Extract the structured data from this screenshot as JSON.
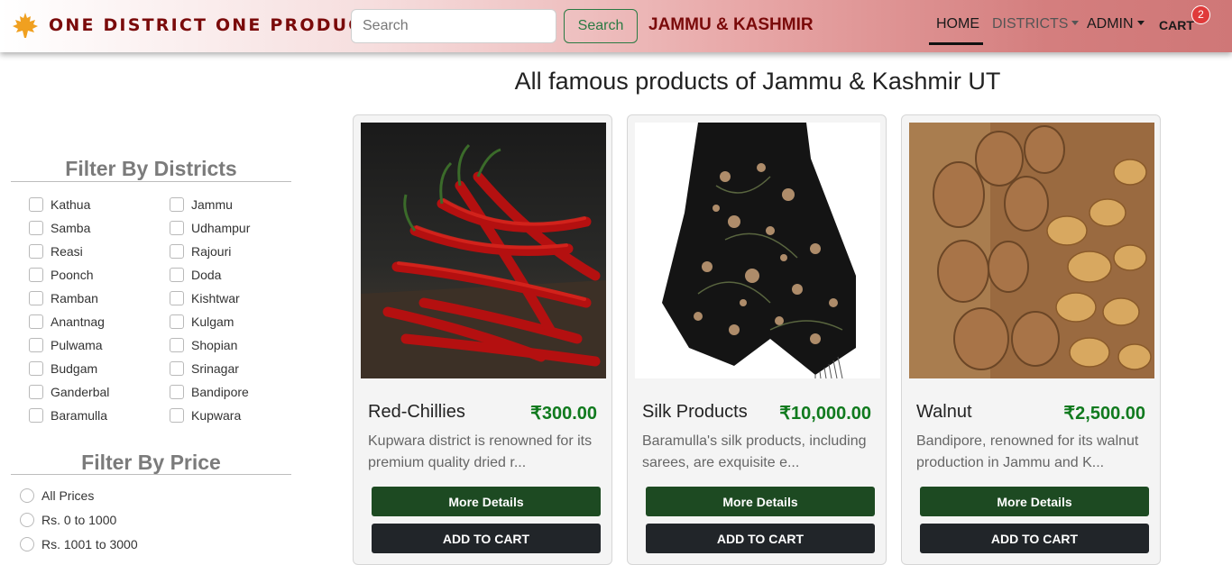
{
  "navbar": {
    "brand_icon": "maple-leaf-icon",
    "brand": "ONE DISTRICT ONE PRODUCT",
    "search_placeholder": "Search",
    "search_button": "Search",
    "state": "JAMMU & KASHMIR",
    "links": {
      "home": "HOME",
      "districts": "DISTRICTS",
      "admin": "ADMIN",
      "cart": "CART"
    },
    "cart_count": "2"
  },
  "colors": {
    "brand": "#7a0a0a",
    "accent_green": "#1d4a22",
    "price_green": "#107a1e",
    "badge_red": "#e03a3a"
  },
  "page_title": "All famous products of Jammu & Kashmir UT",
  "filters": {
    "districts_heading": "Filter By Districts",
    "districts_col1": [
      "Kathua",
      "Samba",
      "Reasi",
      "Poonch",
      "Ramban",
      "Anantnag",
      "Pulwama",
      "Budgam",
      "Ganderbal",
      "Baramulla"
    ],
    "districts_col2": [
      "Jammu",
      "Udhampur",
      "Rajouri",
      "Doda",
      "Kishtwar",
      "Kulgam",
      "Shopian",
      "Srinagar",
      "Bandipore",
      "Kupwara"
    ],
    "price_heading": "Filter By Price",
    "prices": [
      "All Prices",
      "Rs. 0 to 1000",
      "Rs. 1001 to 3000"
    ]
  },
  "products": [
    {
      "name": "Red-Chillies",
      "price": "₹300.00",
      "description": "Kupwara district is renowned for its premium quality dried r...",
      "details_label": "More Details",
      "cart_label": "ADD TO CART"
    },
    {
      "name": "Silk Products",
      "price": "₹10,000.00",
      "description": "Baramulla's silk products, including sarees, are exquisite e...",
      "details_label": "More Details",
      "cart_label": "ADD TO CART"
    },
    {
      "name": "Walnut",
      "price": "₹2,500.00",
      "description": "Bandipore, renowned for its walnut production in Jammu and K...",
      "details_label": "More Details",
      "cart_label": "ADD TO CART"
    }
  ]
}
